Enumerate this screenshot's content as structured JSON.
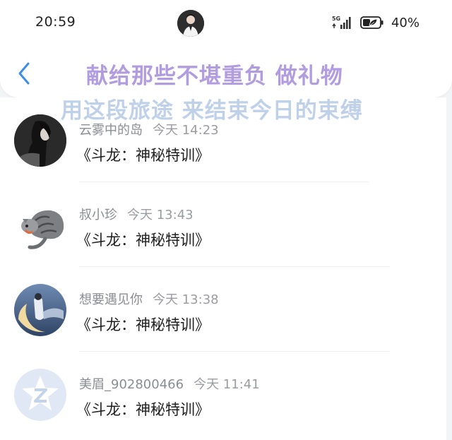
{
  "status_bar": {
    "time": "20:59",
    "network_label": "5G",
    "battery": "40%"
  },
  "header": {
    "back_icon": "chevron-left-icon"
  },
  "overlay_text": {
    "line1": "献给那些不堪重负 做礼物",
    "line2": "用这段旅途 来结束今日的束缚"
  },
  "messages": [
    {
      "name": "云雾中的岛",
      "time": "今天 14:23",
      "text": "《斗龙：神秘特训》"
    },
    {
      "name": "叔小珍",
      "time": "今天 13:43",
      "text": "《斗龙：神秘特训》"
    },
    {
      "name": "想要遇见你",
      "time": "今天 13:38",
      "text": "《斗龙：神秘特训》"
    },
    {
      "name": "美眉_902800466",
      "time": "今天 11:41",
      "text": "《斗龙：神秘特训》"
    }
  ],
  "colors": {
    "accent_blue": "#3d8ee8",
    "overlay_purple": "#a78fdc",
    "overlay_blue": "#b9cde6"
  }
}
